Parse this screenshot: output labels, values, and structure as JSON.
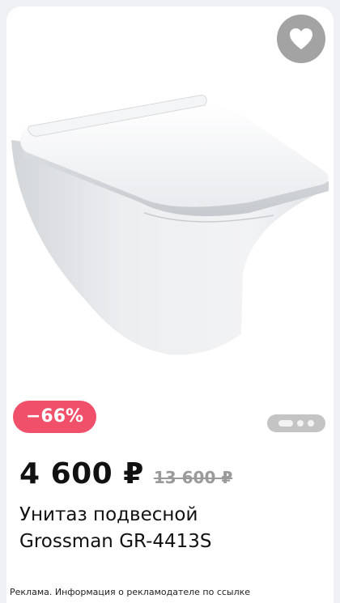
{
  "product": {
    "image_alt": "toilet-product-photo",
    "discount_badge": "−66%",
    "price": "4 600 ₽",
    "old_price": "13 600 ₽",
    "title_line1": "Унитаз подвесной",
    "title_line2": "Grossman GR-4413S"
  },
  "gallery": {
    "dots": 3,
    "active": 0
  },
  "ad_disclaimer": "Реклама. Информация о рекламодателе по ссылке",
  "colors": {
    "badge": "#f0506a",
    "favorite_button": "#a3a3a3",
    "dots_pill": "#c4c4c4"
  },
  "icons": {
    "favorite": "heart-icon"
  }
}
